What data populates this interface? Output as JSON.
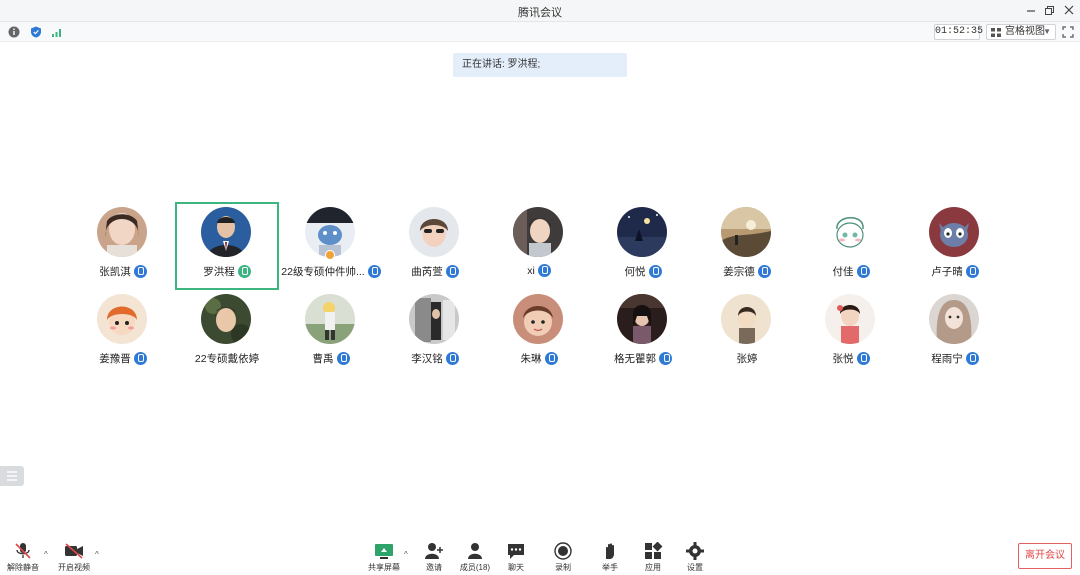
{
  "window": {
    "title": "腾讯会议"
  },
  "infobar": {
    "timer": "01:52:35",
    "view_mode": "宫格视图"
  },
  "speaking": {
    "text": "正在讲话: 罗洪程;"
  },
  "participants": [
    {
      "name": "张凯淇"
    },
    {
      "name": "罗洪程"
    },
    {
      "name": "22级专硕仲件帅..."
    },
    {
      "name": "曲芮萱"
    },
    {
      "name": "xi"
    },
    {
      "name": "何悦"
    },
    {
      "name": "姜宗德"
    },
    {
      "name": "付佳"
    },
    {
      "name": "卢子晴"
    },
    {
      "name": "姜豫晋"
    },
    {
      "name": "22专硕戴依婷"
    },
    {
      "name": "曹禹"
    },
    {
      "name": "李汉铭"
    },
    {
      "name": "朱琳"
    },
    {
      "name": "格无瞿郭"
    },
    {
      "name": "张婷"
    },
    {
      "name": "张悦"
    },
    {
      "name": "程雨宁"
    }
  ],
  "toolbar": {
    "unmute": "解除静音",
    "start_video": "开启视频",
    "share_screen": "共享屏幕",
    "invite": "邀请",
    "members": "成员(18)",
    "chat": "聊天",
    "record": "录制",
    "raise_hand": "举手",
    "apps": "应用",
    "settings": "设置",
    "leave": "离开会议"
  },
  "colors": {
    "accent_blue": "#2e7ad6",
    "active_border": "#3cb580",
    "leave_red": "#e04848",
    "banner_bg": "#e4eefb"
  }
}
